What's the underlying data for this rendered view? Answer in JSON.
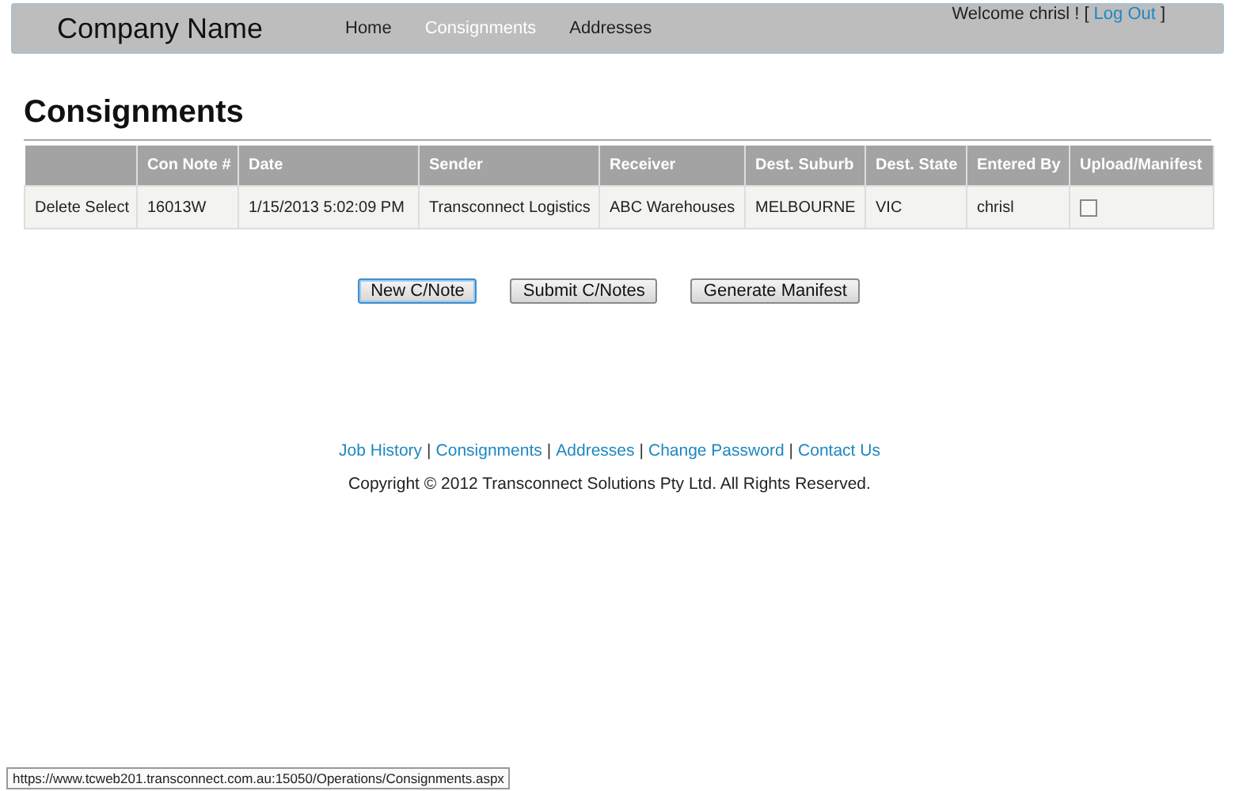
{
  "header": {
    "brand": "Company Name",
    "nav": [
      {
        "label": "Home",
        "selected": false
      },
      {
        "label": "Consignments",
        "selected": true
      },
      {
        "label": "Addresses",
        "selected": false
      }
    ],
    "welcome": {
      "text": "Welcome chrisl !",
      "open": "[",
      "link": "Log Out",
      "close": "]"
    }
  },
  "page_title": "Consignments",
  "table": {
    "columns": [
      "",
      "Con Note #",
      "Date",
      "Sender",
      "Receiver",
      "Dest. Suburb",
      "Dest. State",
      "Entered By",
      "Upload/Manifest"
    ],
    "rows": [
      {
        "cells": [
          "Delete Select",
          "16013W",
          "1/15/2013 5:02:09 PM",
          "Transconnect Logistics",
          "ABC Warehouses",
          "MELBOURNE",
          "VIC",
          "chrisl"
        ],
        "checked": false
      }
    ]
  },
  "buttons": [
    {
      "label": "New C/Note",
      "focused": true
    },
    {
      "label": "Submit C/Notes",
      "focused": false
    },
    {
      "label": "Generate Manifest",
      "focused": false
    }
  ],
  "footer": {
    "links": [
      "Job History",
      "Consignments",
      "Addresses",
      "Change Password",
      "Contact Us"
    ],
    "separator": "|",
    "copyright": "Copyright © 2012 Transconnect Solutions Pty Ltd. All Rights Reserved."
  },
  "status_bar": "https://www.tcweb201.transconnect.com.au:15050/Operations/Consignments.aspx"
}
